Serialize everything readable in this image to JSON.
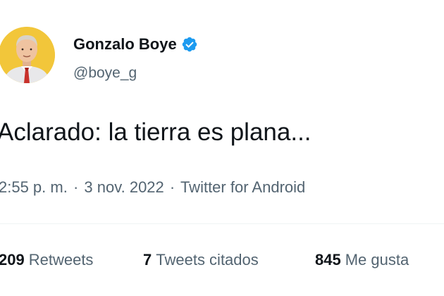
{
  "tweet": {
    "author": {
      "display_name": "Gonzalo Boye",
      "handle": "@boye_g",
      "verified_icon": "verified-badge-icon",
      "avatar_icon": "avatar-illustration-icon"
    },
    "text": "Aclarado: la tierra es plana...",
    "meta": {
      "time": "2:55 p. m.",
      "separator": "·",
      "date": "3 nov. 2022",
      "source": "Twitter for Android"
    },
    "stats": [
      {
        "count": "209",
        "label": "Retweets"
      },
      {
        "count": "7",
        "label": "Tweets citados"
      },
      {
        "count": "845",
        "label": "Me gusta"
      }
    ]
  },
  "colors": {
    "text_primary": "#0f1419",
    "text_secondary": "#536471",
    "verified_blue": "#1d9bf0",
    "avatar_background": "#f2c63a",
    "divider": "#eff3f4"
  }
}
